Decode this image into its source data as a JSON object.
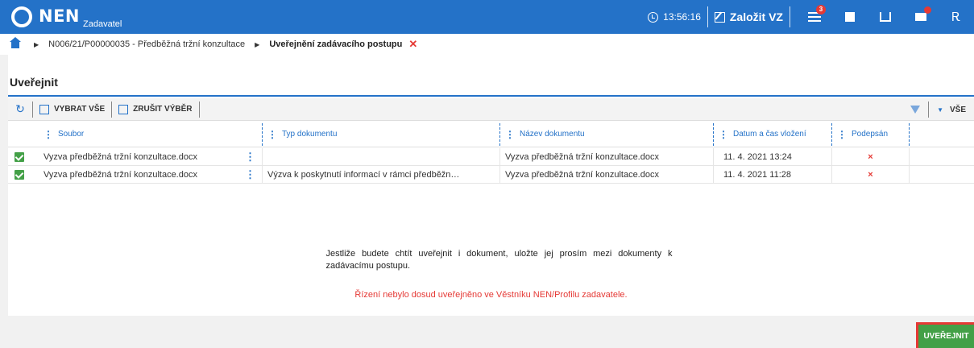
{
  "header": {
    "logo_text": "NEN",
    "logo_sub": "Zadavatel",
    "time": "13:56:16",
    "new_vz_label": "Založit VZ",
    "notification_count": "3"
  },
  "breadcrumb": {
    "item1": "N006/21/P00000035 - Předběžná tržní konzultace",
    "current": "Uveřejnění zadávacího postupu"
  },
  "panel": {
    "title": "Uveřejnit"
  },
  "toolbar": {
    "select_all": "VYBRAT VŠE",
    "deselect": "ZRUŠIT VÝBĚR",
    "view_all": "VŠE"
  },
  "grid": {
    "columns": [
      "Soubor",
      "Typ dokumentu",
      "Název dokumentu",
      "Datum a čas vložení",
      "Podepsán"
    ],
    "rows": [
      {
        "file": "Vyzva předběžná tržní konzultace.docx",
        "type": "",
        "name": "Vyzva předběžná tržní konzultace.docx",
        "datetime": "11. 4. 2021 13:24",
        "signed": "×"
      },
      {
        "file": "Vyzva předběžná tržní konzultace.docx",
        "type": "Výzva k poskytnutí informací v rámci předběžn…",
        "name": "Vyzva předběžná tržní konzultace.docx",
        "datetime": "11. 4. 2021 11:28",
        "signed": "×"
      }
    ]
  },
  "info": {
    "text": "Jestliže budete chtít uveřejnit i dokument, uložte jej prosím mezi dokumenty k zadávacímu postupu.",
    "warning": "Řízení nebylo dosud uveřejněno ve Věstníku NEN/Profilu zadavatele."
  },
  "actions": {
    "publish": "UVEŘEJNIT"
  },
  "colors": {
    "primary": "#2472c8",
    "danger": "#e53935",
    "success": "#43a047"
  }
}
